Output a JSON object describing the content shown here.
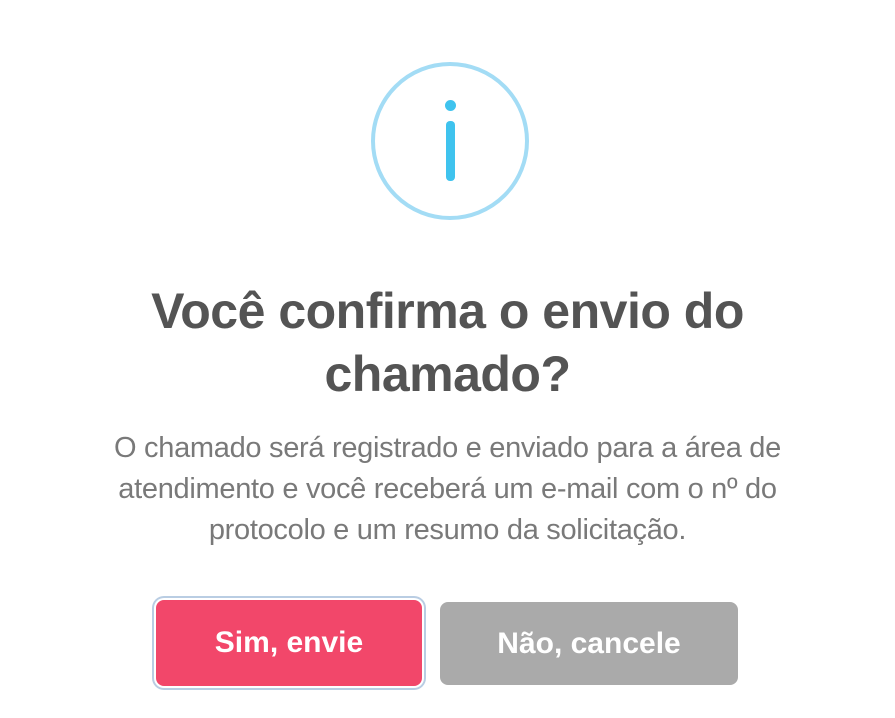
{
  "dialog": {
    "icon": "info-icon",
    "title": "Você confirma o envio do chamado?",
    "message": "O chamado será registrado e enviado para a área de atendimento e você receberá um e-mail com o nº do protocolo e um resumo da solicitação.",
    "confirm_label": "Sim, envie",
    "cancel_label": "Não, cancele"
  },
  "colors": {
    "icon_ring": "#a3dcf5",
    "icon_glyph": "#3fc3ee",
    "title_text": "#545454",
    "message_text": "#797979",
    "confirm_button": "#f2476a",
    "cancel_button": "#aaaaaa"
  }
}
